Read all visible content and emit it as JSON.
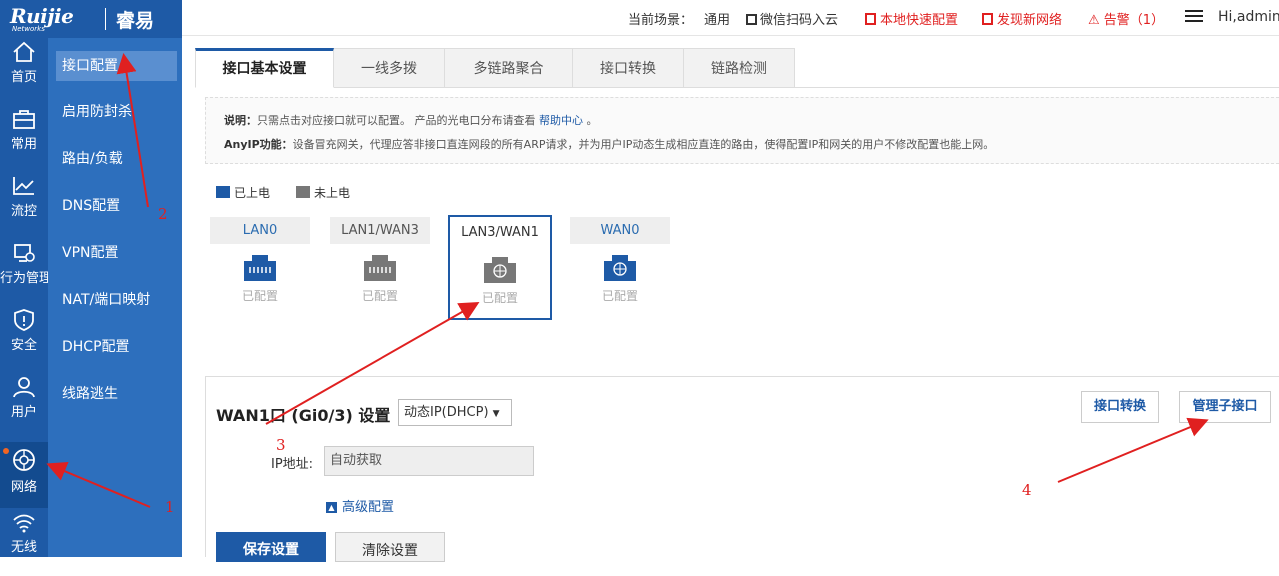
{
  "logo": {
    "brand": "Ruijie",
    "sub": "Networks",
    "cn": "睿易"
  },
  "nav": [
    {
      "label": "首页",
      "icon": "home-icon"
    },
    {
      "label": "常用",
      "icon": "briefcase-icon"
    },
    {
      "label": "流控",
      "icon": "chart-line-icon"
    },
    {
      "label": "行为管理",
      "icon": "monitor-eye-icon"
    },
    {
      "label": "安全",
      "icon": "shield-icon"
    },
    {
      "label": "用户",
      "icon": "user-icon"
    },
    {
      "label": "网络",
      "icon": "globe-icon"
    },
    {
      "label": "无线",
      "icon": "wifi-icon"
    }
  ],
  "subnav": [
    "接口配置",
    "启用防封杀",
    "路由/负载",
    "DNS配置",
    "VPN配置",
    "NAT/端口映射",
    "DHCP配置",
    "线路逃生"
  ],
  "topbar": {
    "scene_label": "当前场景：",
    "scene_value": "通用",
    "wechat": "微信扫码入云",
    "quick": "本地快速配置",
    "discover": "发现新网络",
    "alarm": "告警（1）",
    "user": "Hi,admin"
  },
  "tabs": [
    "接口基本设置",
    "一线多拨",
    "多链路聚合",
    "接口转换",
    "链路检测"
  ],
  "note": {
    "l1_label": "说明：",
    "l1_text": "只需点击对应接口就可以配置。 产品的光电口分布请查看 ",
    "l1_link": "帮助中心",
    "l1_end": " 。",
    "l2_label": "AnyIP功能：",
    "l2_text": "设备冒充网关，代理应答非接口直连网段的所有ARP请求，并为用户IP动态生成相应直连的路由，使得配置IP和网关的用户不修改配置也能上网。"
  },
  "legend": {
    "powered": "已上电",
    "unpowered": "未上电"
  },
  "ports": [
    {
      "name": "LAN0",
      "status": "已配置"
    },
    {
      "name": "LAN1/WAN3",
      "status": "已配置"
    },
    {
      "name": "LAN3/WAN1",
      "status": "已配置"
    },
    {
      "name": "WAN0",
      "status": "已配置"
    }
  ],
  "wan": {
    "title": "WAN1口 (Gi0/3) 设置",
    "mode": "动态IP(DHCP)",
    "convert_btn": "接口转换",
    "sub_btn": "管理子接口",
    "ip_label": "IP地址:",
    "ip_value": "自动获取",
    "advanced": "高级配置",
    "save": "保存设置",
    "clear": "清除设置"
  },
  "annotations": [
    "1",
    "2",
    "3",
    "4"
  ],
  "colors": {
    "primary": "#1e5aa6",
    "accent": "#e02020",
    "subnav": "#2d6fbd"
  }
}
